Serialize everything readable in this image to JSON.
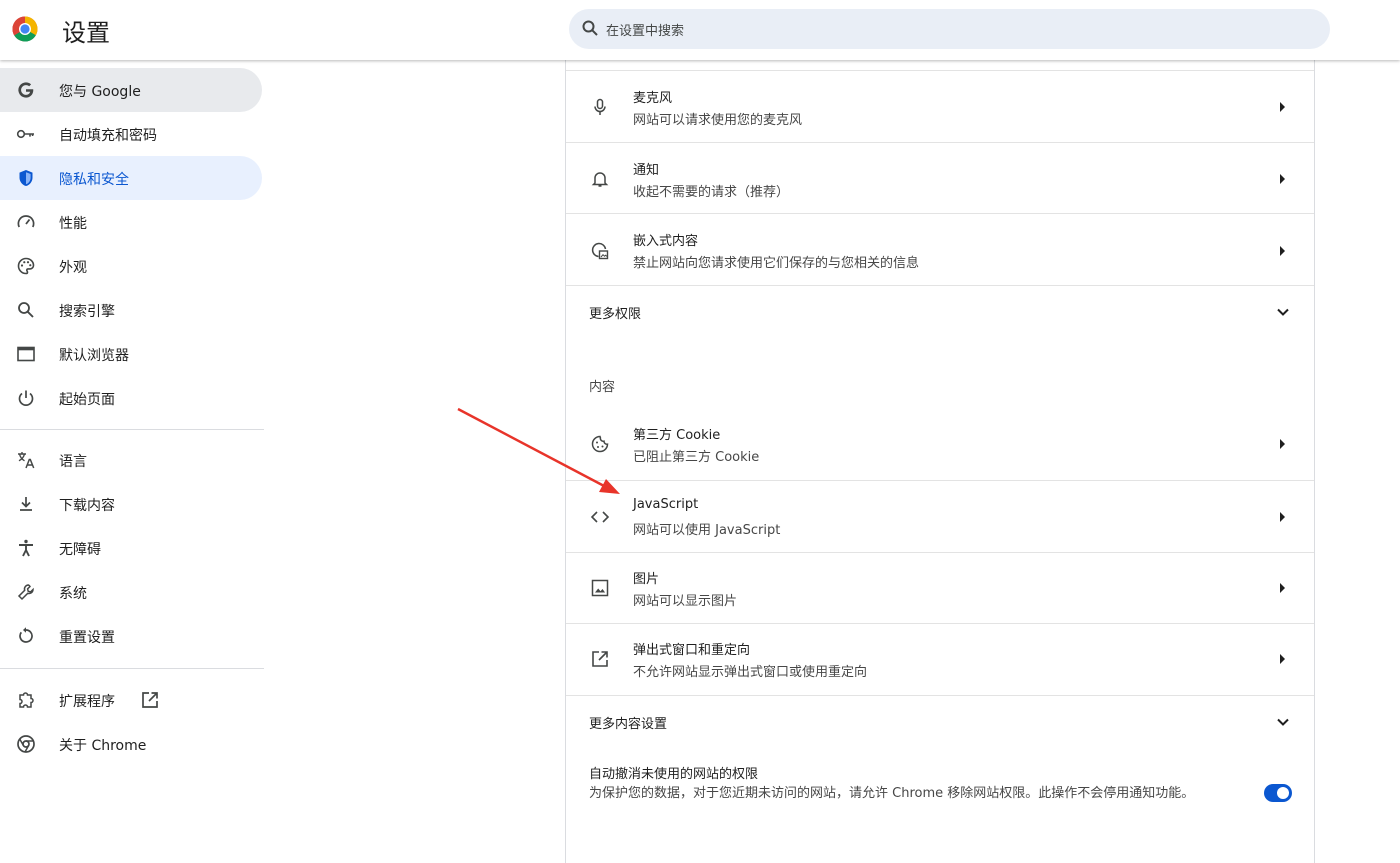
{
  "header": {
    "title": "设置",
    "search_placeholder": "在设置中搜索"
  },
  "sidebar": {
    "items": [
      {
        "label": "您与 Google",
        "icon": "google-g-icon"
      },
      {
        "label": "自动填充和密码",
        "icon": "key-icon"
      },
      {
        "label": "隐私和安全",
        "icon": "shield-icon",
        "active": true
      },
      {
        "label": "性能",
        "icon": "speedometer-icon"
      },
      {
        "label": "外观",
        "icon": "palette-icon"
      },
      {
        "label": "搜索引擎",
        "icon": "search-icon"
      },
      {
        "label": "默认浏览器",
        "icon": "browser-window-icon"
      },
      {
        "label": "起始页面",
        "icon": "power-icon"
      },
      {
        "label": "语言",
        "icon": "translate-icon"
      },
      {
        "label": "下载内容",
        "icon": "download-icon"
      },
      {
        "label": "无障碍",
        "icon": "accessibility-icon"
      },
      {
        "label": "系统",
        "icon": "wrench-icon"
      },
      {
        "label": "重置设置",
        "icon": "reset-icon"
      },
      {
        "label": "扩展程序",
        "icon": "puzzle-icon"
      },
      {
        "label": "关于 Chrome",
        "icon": "chrome-icon"
      }
    ]
  },
  "content": {
    "permissions": [
      {
        "title": "麦克风",
        "subtitle": "网站可以请求使用您的麦克风",
        "icon": "microphone-icon"
      },
      {
        "title": "通知",
        "subtitle": "收起不需要的请求（推荐）",
        "icon": "bell-icon"
      },
      {
        "title": "嵌入式内容",
        "subtitle": "禁止网站向您请求使用它们保存的与您相关的信息",
        "icon": "embedded-content-icon"
      }
    ],
    "more_permissions_label": "更多权限",
    "content_section_label": "内容",
    "content_items": [
      {
        "title": "第三方 Cookie",
        "subtitle": "已阻止第三方 Cookie",
        "icon": "cookie-icon"
      },
      {
        "title": "JavaScript",
        "subtitle": "网站可以使用 JavaScript",
        "icon": "code-icon"
      },
      {
        "title": "图片",
        "subtitle": "网站可以显示图片",
        "icon": "image-icon"
      },
      {
        "title": "弹出式窗口和重定向",
        "subtitle": "不允许网站显示弹出式窗口或使用重定向",
        "icon": "open-in-new-icon"
      }
    ],
    "more_content_label": "更多内容设置",
    "auto_revoke": {
      "title": "自动撤消未使用的网站的权限",
      "description": "为保护您的数据，对于您近期未访问的网站，请允许 Chrome 移除网站权限。此操作不会停用通知功能。",
      "enabled": true
    }
  },
  "colors": {
    "accent": "#0b57d0",
    "active_nav_bg": "#e8f0fe",
    "annotation_arrow": "#e8342a"
  }
}
